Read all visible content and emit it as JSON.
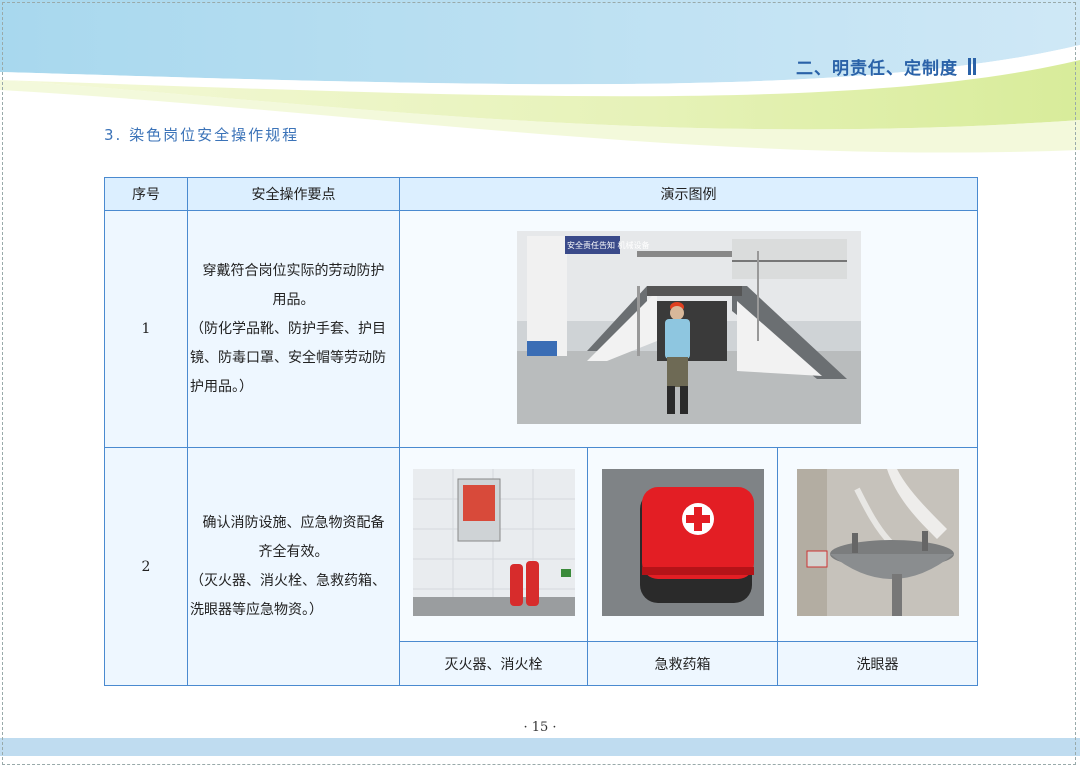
{
  "header": {
    "chapter_title": "二、明责任、定制度"
  },
  "section": {
    "title": "3. 染色岗位安全操作规程"
  },
  "table": {
    "headers": {
      "index": "序号",
      "points": "安全操作要点",
      "illustration": "演示图例"
    },
    "rows": [
      {
        "index": "1",
        "point_main": "穿戴符合岗位实际的劳动防护用品。",
        "point_note": "（防化学品靴、防护手套、护目镜、防毒口罩、安全帽等劳动防护用品。）",
        "sign_text": "安全责任告知 机械设备"
      },
      {
        "index": "2",
        "point_main": "确认消防设施、应急物资配备齐全有效。",
        "point_note": "（灭火器、消火栓、急救药箱、洗眼器等应急物资。）",
        "captions": [
          "灭火器、消火栓",
          "急救药箱",
          "洗眼器"
        ]
      }
    ]
  },
  "footer": {
    "page_number": "· 15 ·"
  },
  "colors": {
    "accent": "#2a62a8",
    "border": "#4a8ad0",
    "header_fill": "#dcefff"
  }
}
